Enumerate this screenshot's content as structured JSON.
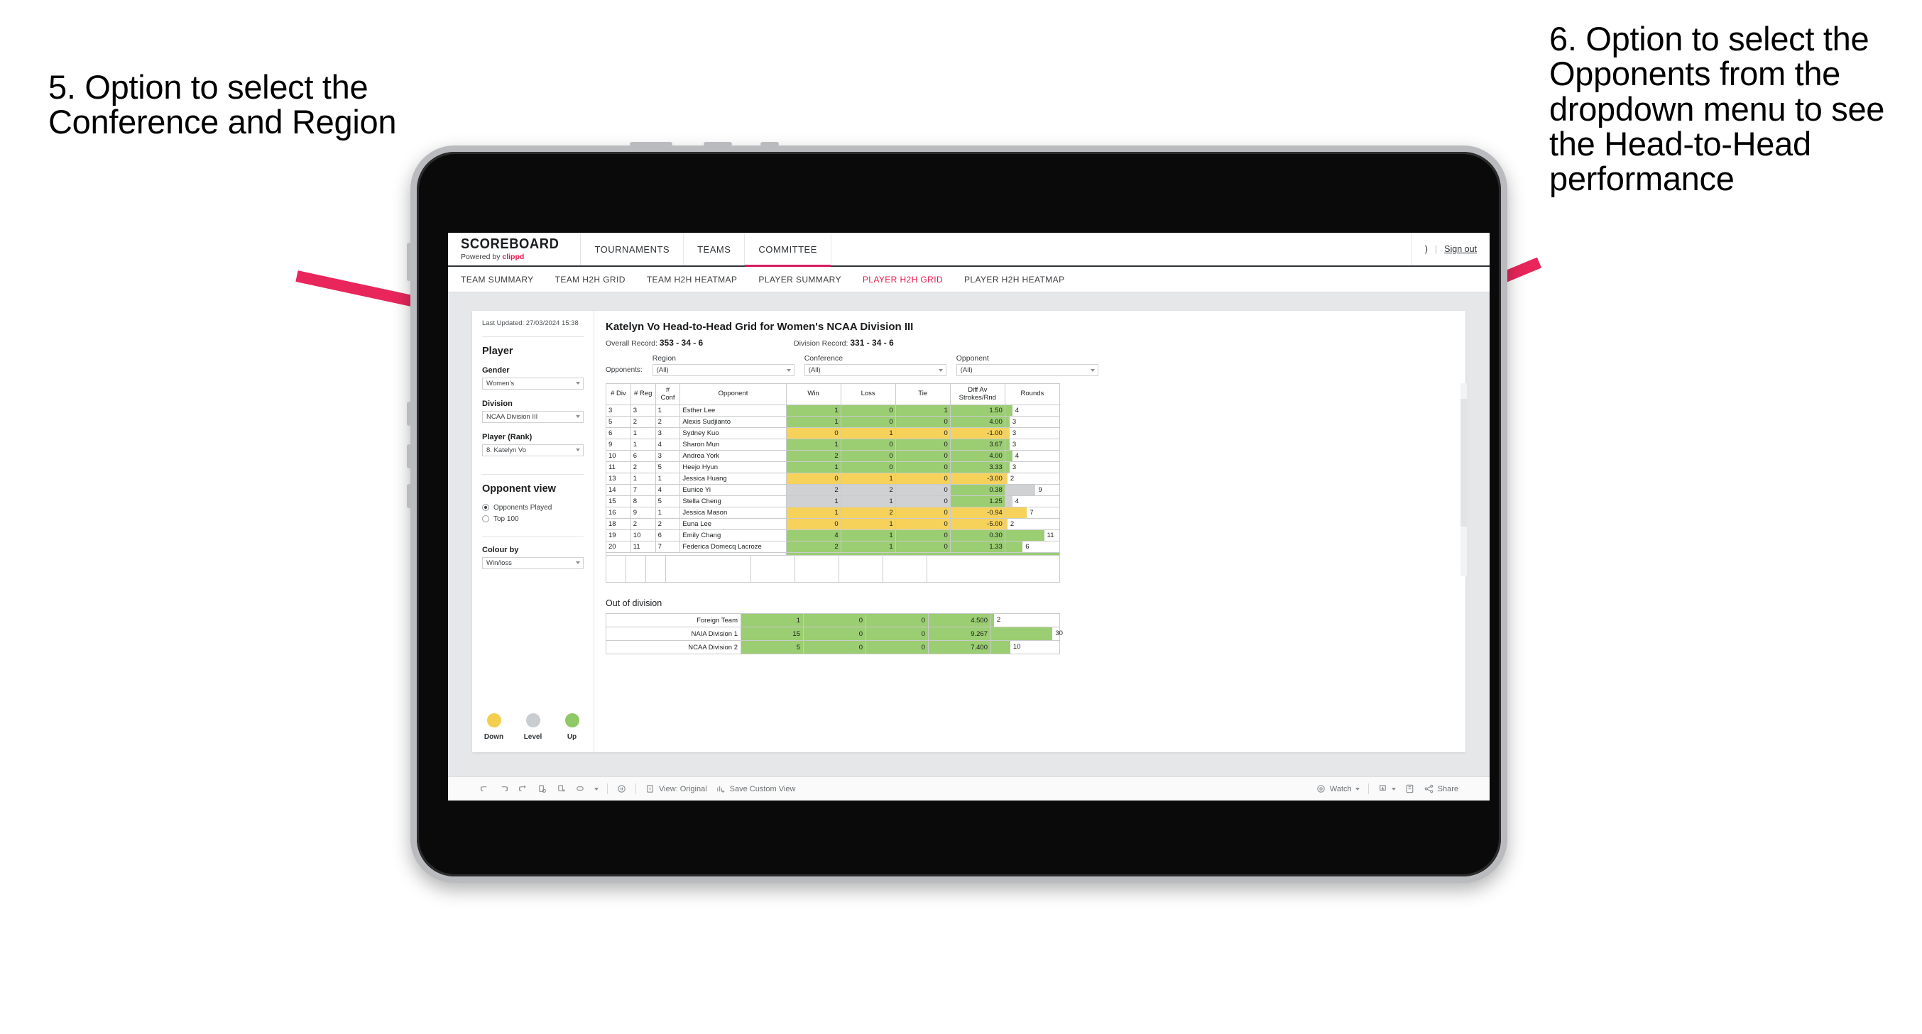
{
  "annotations": {
    "left": "5. Option to select the Conference and Region",
    "right": "6. Option to select the Opponents from the dropdown menu to see the Head-to-Head performance",
    "arrow_color": "#e8265c"
  },
  "topnav": {
    "brand_name": "SCOREBOARD",
    "brand_sub_prefix": "Powered by ",
    "brand_sub_brand": "clippd",
    "items": [
      {
        "label": "TOURNAMENTS",
        "active": false
      },
      {
        "label": "TEAMS",
        "active": false
      },
      {
        "label": "COMMITTEE",
        "active": true
      }
    ],
    "right_glyph": ")",
    "separator": "|",
    "signout": "Sign out",
    "accent": "#d81b60"
  },
  "subnav": {
    "items": [
      {
        "label": "TEAM SUMMARY",
        "active": false
      },
      {
        "label": "TEAM H2H GRID",
        "active": false
      },
      {
        "label": "TEAM H2H HEATMAP",
        "active": false
      },
      {
        "label": "PLAYER SUMMARY",
        "active": false
      },
      {
        "label": "PLAYER H2H GRID",
        "active": true
      },
      {
        "label": "PLAYER H2H HEATMAP",
        "active": false
      }
    ],
    "active_color": "#e8174c"
  },
  "sidebar": {
    "last_updated": "Last Updated: 27/03/2024 15:38",
    "panel_title": "Player",
    "fields": [
      {
        "label": "Gender",
        "value": "Women's"
      },
      {
        "label": "Division",
        "value": "NCAA Division III"
      },
      {
        "label": "Player (Rank)",
        "value": "8. Katelyn Vo"
      }
    ],
    "opponent_view": {
      "title": "Opponent view",
      "options": [
        {
          "label": "Opponents Played",
          "selected": true
        },
        {
          "label": "Top 100",
          "selected": false
        }
      ]
    },
    "colour_by": {
      "label": "Colour by",
      "value": "Win/loss"
    },
    "legend": [
      {
        "label": "Down",
        "color": "#f4cf4f"
      },
      {
        "label": "Level",
        "color": "#cacdd0"
      },
      {
        "label": "Up",
        "color": "#8fc866"
      }
    ]
  },
  "main": {
    "title": "Katelyn Vo Head-to-Head Grid for Women's NCAA Division III",
    "overall_label": "Overall Record: ",
    "overall_value": "353 - 34 - 6",
    "division_label": "Division Record: ",
    "division_value": "331 - 34 - 6",
    "opponents_label": "Opponents:",
    "filters": [
      {
        "label": "Region",
        "value": "(All)"
      },
      {
        "label": "Conference",
        "value": "(All)"
      },
      {
        "label": "Opponent",
        "value": "(All)"
      }
    ]
  },
  "grid": {
    "headers": {
      "div": "# Div",
      "reg": "# Reg",
      "conf": "# Conf",
      "opponent": "Opponent",
      "win": "Win",
      "loss": "Loss",
      "tie": "Tie",
      "diff": "Diff Av Strokes/Rnd",
      "rounds": "Rounds"
    },
    "rows": [
      {
        "div": "3",
        "reg": "3",
        "conf": "1",
        "opponent": "Esther Lee",
        "win": "1",
        "loss": "0",
        "tie": "1",
        "diff": "1.50",
        "rounds": "4",
        "fill": "green",
        "bar_pct": 13
      },
      {
        "div": "5",
        "reg": "2",
        "conf": "2",
        "opponent": "Alexis Sudjianto",
        "win": "1",
        "loss": "0",
        "tie": "0",
        "diff": "4.00",
        "rounds": "3",
        "fill": "green",
        "bar_pct": 8
      },
      {
        "div": "6",
        "reg": "1",
        "conf": "3",
        "opponent": "Sydney Kuo",
        "win": "0",
        "loss": "1",
        "tie": "0",
        "diff": "-1.00",
        "rounds": "3",
        "fill": "yellow",
        "bar_pct": 8
      },
      {
        "div": "9",
        "reg": "1",
        "conf": "4",
        "opponent": "Sharon Mun",
        "win": "1",
        "loss": "0",
        "tie": "0",
        "diff": "3.67",
        "rounds": "3",
        "fill": "green",
        "bar_pct": 8
      },
      {
        "div": "10",
        "reg": "6",
        "conf": "3",
        "opponent": "Andrea York",
        "win": "2",
        "loss": "0",
        "tie": "0",
        "diff": "4.00",
        "rounds": "4",
        "fill": "green",
        "bar_pct": 13
      },
      {
        "div": "11",
        "reg": "2",
        "conf": "5",
        "opponent": "Heejo Hyun",
        "win": "1",
        "loss": "0",
        "tie": "0",
        "diff": "3.33",
        "rounds": "3",
        "fill": "green",
        "bar_pct": 8
      },
      {
        "div": "13",
        "reg": "1",
        "conf": "1",
        "opponent": "Jessica Huang",
        "win": "0",
        "loss": "1",
        "tie": "0",
        "diff": "-3.00",
        "rounds": "2",
        "fill": "yellow",
        "bar_pct": 4
      },
      {
        "div": "14",
        "reg": "7",
        "conf": "4",
        "opponent": "Eunice Yi",
        "win": "2",
        "loss": "2",
        "tie": "0",
        "diff": "0.38",
        "rounds": "9",
        "fill": "grey",
        "bar_pct": 56,
        "diff_fill": "green"
      },
      {
        "div": "15",
        "reg": "8",
        "conf": "5",
        "opponent": "Stella Cheng",
        "win": "1",
        "loss": "1",
        "tie": "0",
        "diff": "1.25",
        "rounds": "4",
        "fill": "grey",
        "bar_pct": 13,
        "diff_fill": "green"
      },
      {
        "div": "16",
        "reg": "9",
        "conf": "1",
        "opponent": "Jessica Mason",
        "win": "1",
        "loss": "2",
        "tie": "0",
        "diff": "-0.94",
        "rounds": "7",
        "fill": "yellow",
        "bar_pct": 40
      },
      {
        "div": "18",
        "reg": "2",
        "conf": "2",
        "opponent": "Euna Lee",
        "win": "0",
        "loss": "1",
        "tie": "0",
        "diff": "-5.00",
        "rounds": "2",
        "fill": "yellow",
        "bar_pct": 4
      },
      {
        "div": "19",
        "reg": "10",
        "conf": "6",
        "opponent": "Emily Chang",
        "win": "4",
        "loss": "1",
        "tie": "0",
        "diff": "0.30",
        "rounds": "11",
        "fill": "green",
        "bar_pct": 72
      },
      {
        "div": "20",
        "reg": "11",
        "conf": "7",
        "opponent": "Federica Domecq Lacroze",
        "win": "2",
        "loss": "1",
        "tie": "0",
        "diff": "1.33",
        "rounds": "6",
        "fill": "green",
        "bar_pct": 32
      }
    ]
  },
  "out_of_division": {
    "title": "Out of division",
    "rows": [
      {
        "name": "Foreign Team",
        "win": "1",
        "loss": "0",
        "tie": "0",
        "diff": "4.500",
        "rounds": "2",
        "fill": "green",
        "bar_pct": 4
      },
      {
        "name": "NAIA Division 1",
        "win": "15",
        "loss": "0",
        "tie": "0",
        "diff": "9.267",
        "rounds": "30",
        "fill": "green",
        "bar_pct": 90
      },
      {
        "name": "NCAA Division 2",
        "win": "5",
        "loss": "0",
        "tie": "0",
        "diff": "7.400",
        "rounds": "10",
        "fill": "green",
        "bar_pct": 28
      }
    ]
  },
  "toolbar": {
    "view_label": "View: Original",
    "save_label": "Save Custom View",
    "watch_label": "Watch",
    "share_label": "Share"
  }
}
